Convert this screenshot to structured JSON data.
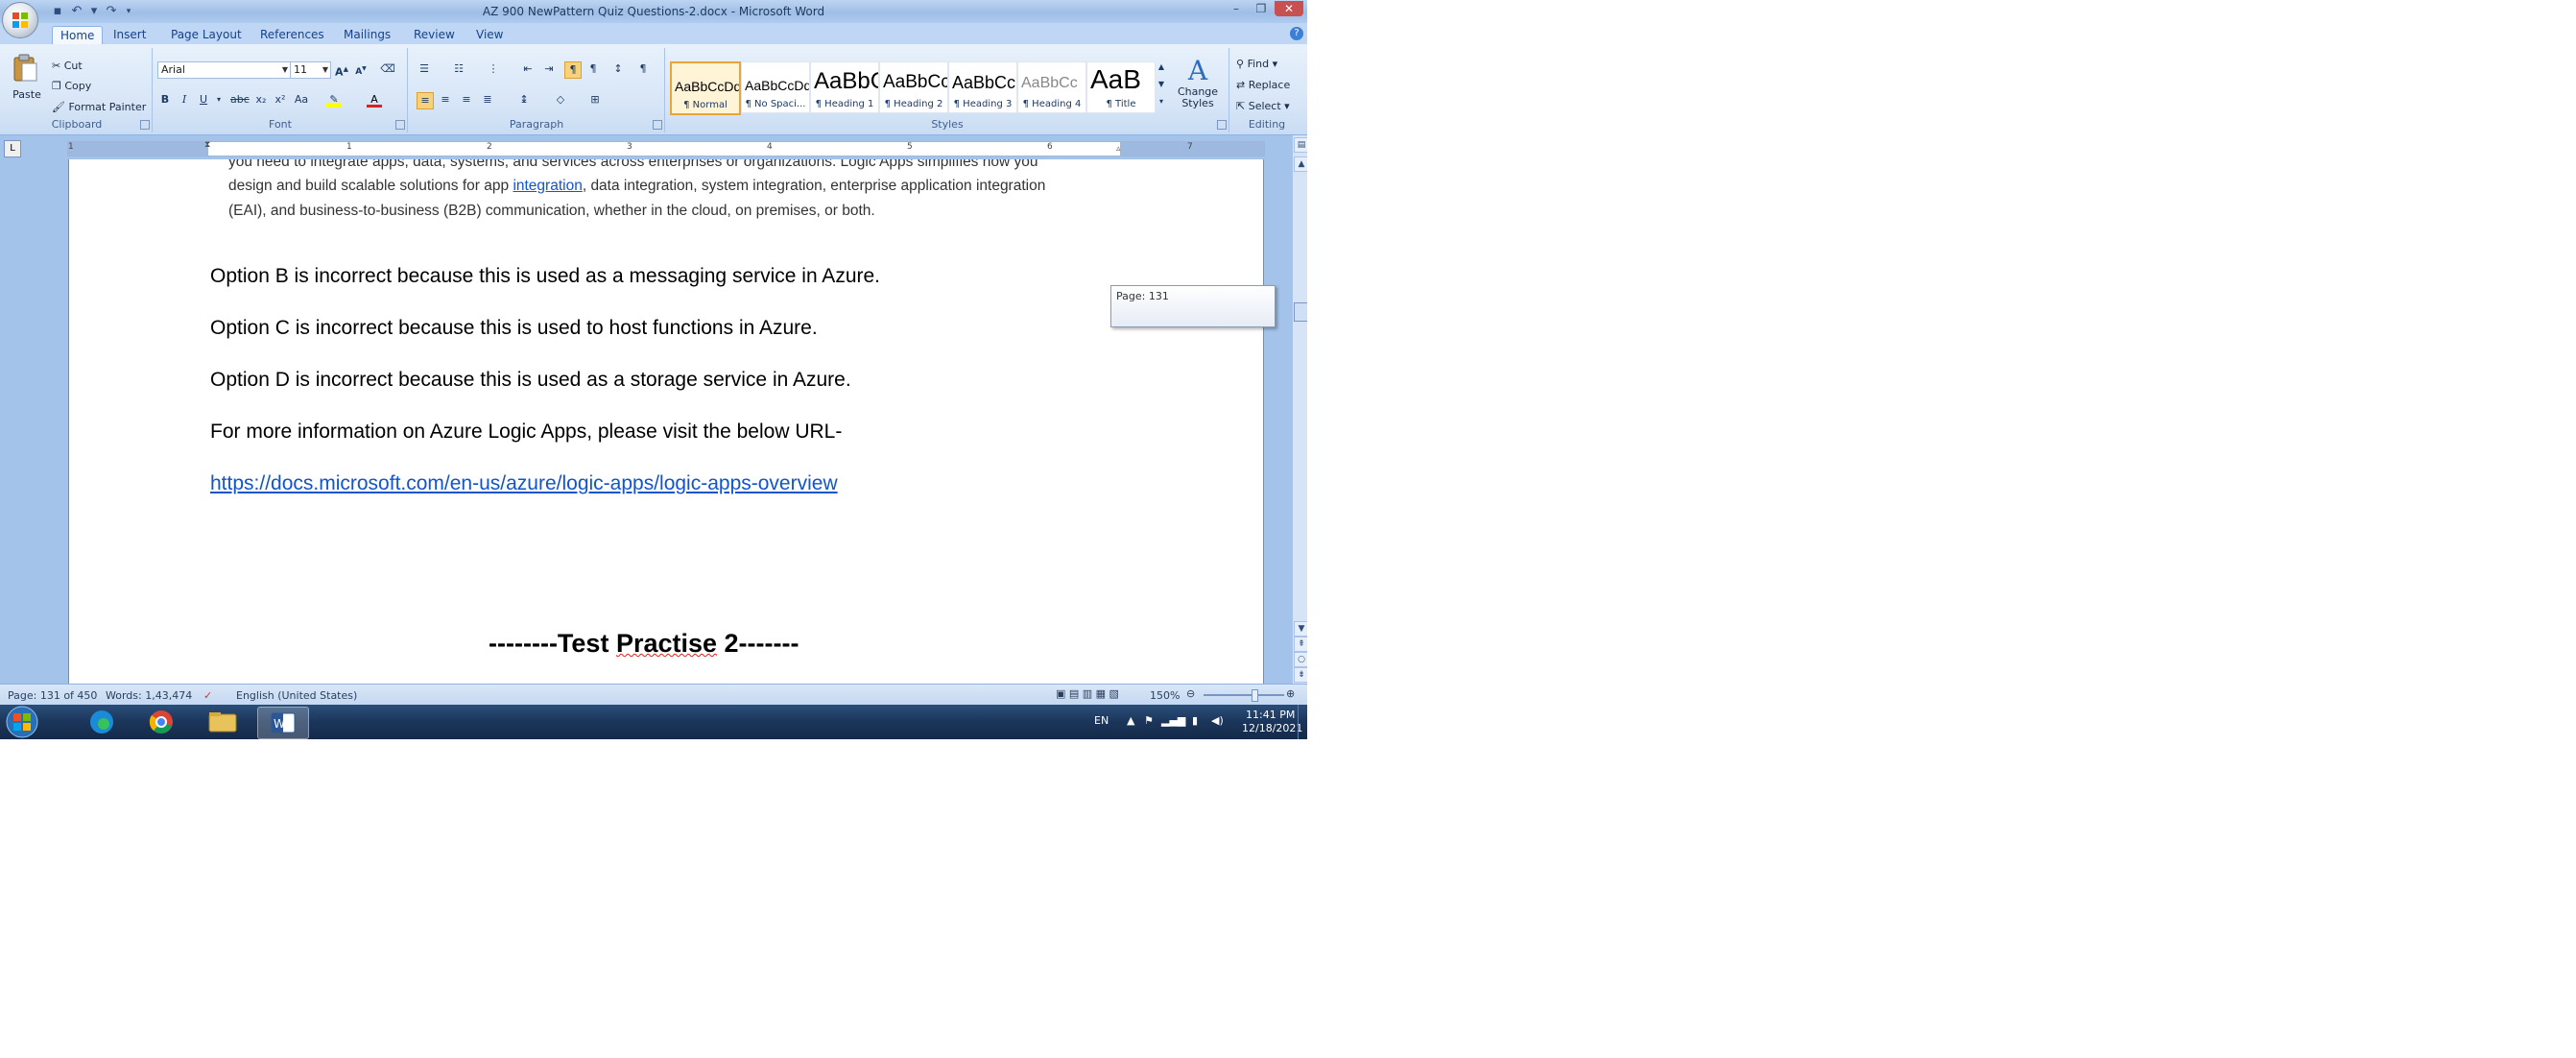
{
  "window": {
    "title": "AZ 900 NewPattern Quiz Questions-2.docx - Microsoft Word"
  },
  "tabs": [
    "Home",
    "Insert",
    "Page Layout",
    "References",
    "Mailings",
    "Review",
    "View"
  ],
  "ribbon": {
    "clipboard": {
      "label": "Clipboard",
      "paste": "Paste",
      "cut": "Cut",
      "copy": "Copy",
      "format_painter": "Format Painter"
    },
    "font": {
      "label": "Font",
      "font_name": "Arial",
      "font_size": "11"
    },
    "paragraph": {
      "label": "Paragraph"
    },
    "styles": {
      "label": "Styles",
      "items": [
        {
          "sample": "AaBbCcDd",
          "name": "¶ Normal"
        },
        {
          "sample": "AaBbCcDd",
          "name": "¶ No Spaci..."
        },
        {
          "sample": "AaBbCc",
          "name": "¶ Heading 1"
        },
        {
          "sample": "AaBbCc",
          "name": "¶ Heading 2"
        },
        {
          "sample": "AaBbCc",
          "name": "¶ Heading 3"
        },
        {
          "sample": "AaBbCc",
          "name": "¶ Heading 4"
        },
        {
          "sample": "AaB",
          "name": "¶ Title"
        }
      ],
      "change_styles": "Change Styles"
    },
    "editing": {
      "label": "Editing",
      "find": "Find",
      "replace": "Replace",
      "select": "Select"
    }
  },
  "ruler": {
    "numbers": [
      "1",
      "1",
      "2",
      "3",
      "4",
      "5",
      "6",
      "7"
    ]
  },
  "document": {
    "partial_para": [
      "you need to integrate apps, data, systems, and services across enterprises or organizations. Logic Apps simplifies how you",
      "design and build scalable solutions for app ",
      "integration",
      ", data integration, system integration, enterprise application integration",
      "(EAI), and business-to-business (B2B) communication, whether in the cloud, on premises, or both."
    ],
    "option_b": "Option B is incorrect because this is used as a messaging service in Azure.",
    "option_c": "Option C is incorrect because this is used to host functions in Azure.",
    "option_d": "Option D is incorrect because this is used as a storage service in Azure.",
    "more_info": "For more information on Azure Logic Apps, please visit the below URL-",
    "url": "https://docs.microsoft.com/en-us/azure/logic-apps/logic-apps-overview",
    "heading_prefix": "--------Test ",
    "heading_word": "Practise",
    "heading_suffix": " 2-------"
  },
  "page_tooltip": "Page: 131",
  "status": {
    "page": "Page: 131 of 450",
    "words": "Words: 1,43,474",
    "language": "English (United States)",
    "zoom": "150%"
  },
  "tray": {
    "lang": "EN",
    "time": "11:41 PM",
    "date": "12/18/2021"
  },
  "colors": {
    "ribbon_bg": "#d6e5f7",
    "doc_bg": "#a4c3ea",
    "link": "#1155cc",
    "taskbar": "#1b355a"
  }
}
